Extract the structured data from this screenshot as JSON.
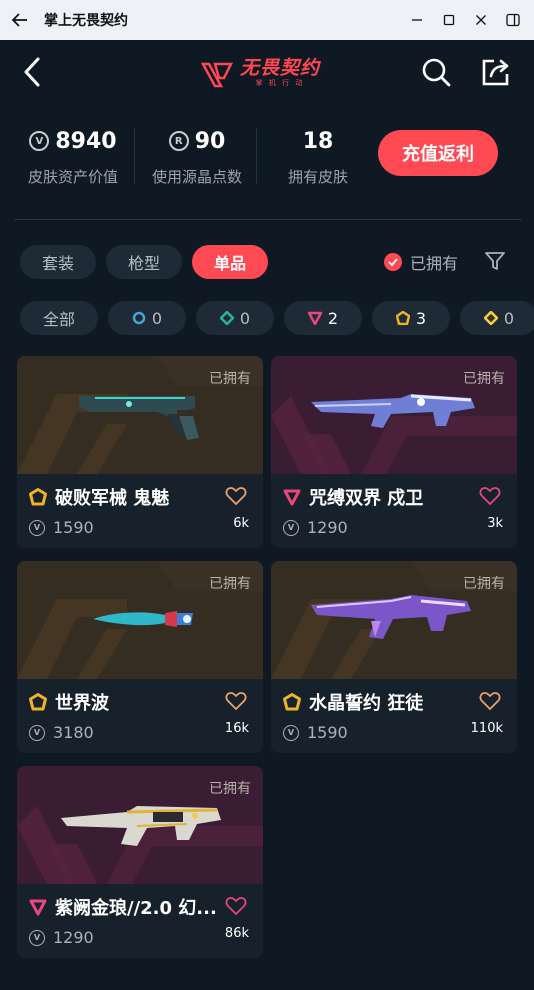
{
  "window": {
    "title": "掌上无畏契约"
  },
  "header": {
    "brand": "无畏契约",
    "brand_sub": "掌 机 行 动"
  },
  "stats": {
    "asset_value": "8940",
    "asset_value_label": "皮肤资产价值",
    "radianite": "90",
    "radianite_label": "使用源晶点数",
    "skins": "18",
    "skins_label": "拥有皮肤",
    "recharge_label": "充值返利"
  },
  "tabs": [
    "套装",
    "枪型",
    "单品"
  ],
  "active_tab": "单品",
  "owned_filter_label": "已拥有",
  "chips": [
    {
      "label": "全部"
    },
    {
      "label": "0",
      "tier": "select"
    },
    {
      "label": "0",
      "tier": "deluxe"
    },
    {
      "label": "2",
      "tier": "premium"
    },
    {
      "label": "3",
      "tier": "exclusive"
    },
    {
      "label": "0",
      "tier": "ultra"
    }
  ],
  "colors": {
    "accent": "#ff4a54",
    "bg": "#0f1923",
    "card": "#16212c",
    "exclusive": "#f0b323",
    "premium": "#e8467f"
  },
  "skins": [
    {
      "name": "破败军械 鬼魅",
      "price": "1590",
      "likes": "6k",
      "owned": "已拥有",
      "tier": "exclusive",
      "weapon": "pistol"
    },
    {
      "name": "咒缚双界 戍卫",
      "price": "1290",
      "likes": "3k",
      "owned": "已拥有",
      "tier": "premium",
      "weapon": "rifle-blue"
    },
    {
      "name": "世界波",
      "price": "3180",
      "likes": "16k",
      "owned": "已拥有",
      "tier": "exclusive",
      "weapon": "knife"
    },
    {
      "name": "水晶誓约 狂徒",
      "price": "1590",
      "likes": "110k",
      "owned": "已拥有",
      "tier": "exclusive",
      "weapon": "rifle-purple"
    },
    {
      "name": "紫阙金琅//2.0 幻...",
      "price": "1290",
      "likes": "86k",
      "owned": "已拥有",
      "tier": "premium",
      "weapon": "rifle-gold"
    }
  ]
}
